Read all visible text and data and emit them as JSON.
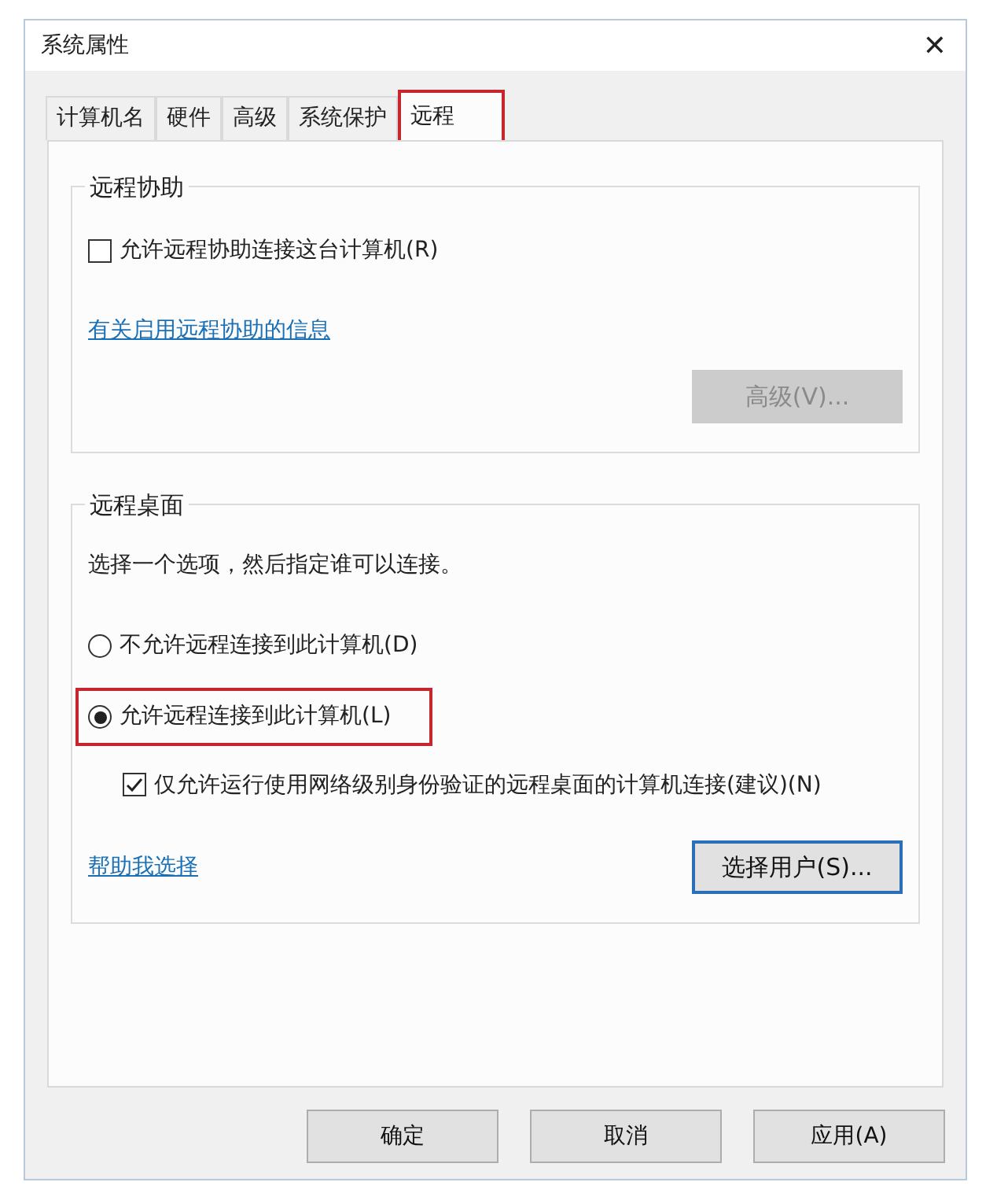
{
  "window": {
    "title": "系统属性",
    "close": "✕"
  },
  "tabs": [
    {
      "label": "计算机名",
      "selected": false,
      "highlighted": false
    },
    {
      "label": "硬件",
      "selected": false,
      "highlighted": false
    },
    {
      "label": "高级",
      "selected": false,
      "highlighted": false
    },
    {
      "label": "系统保护",
      "selected": false,
      "highlighted": false
    },
    {
      "label": "远程",
      "selected": true,
      "highlighted": true
    }
  ],
  "remote_assistance": {
    "title": "远程协助",
    "checkbox": {
      "label": "允许远程协助连接这台计算机(R)",
      "checked": false
    },
    "link": "有关启用远程协助的信息",
    "button": {
      "label": "高级(V)...",
      "disabled": true
    }
  },
  "remote_desktop": {
    "title": "远程桌面",
    "instruction": "选择一个选项，然后指定谁可以连接。",
    "options": [
      {
        "label": "不允许远程连接到此计算机(D)",
        "selected": false,
        "highlighted": false
      },
      {
        "label": "允许远程连接到此计算机(L)",
        "selected": true,
        "highlighted": true
      }
    ],
    "nla_checkbox": {
      "label": "仅允许运行使用网络级别身份验证的远程桌面的计算机连接(建议)(N)",
      "checked": true
    },
    "link": "帮助我选择",
    "button": {
      "label": "选择用户(S)...",
      "disabled": false
    }
  },
  "buttons": [
    "确定",
    "取消",
    "应用(A)"
  ]
}
